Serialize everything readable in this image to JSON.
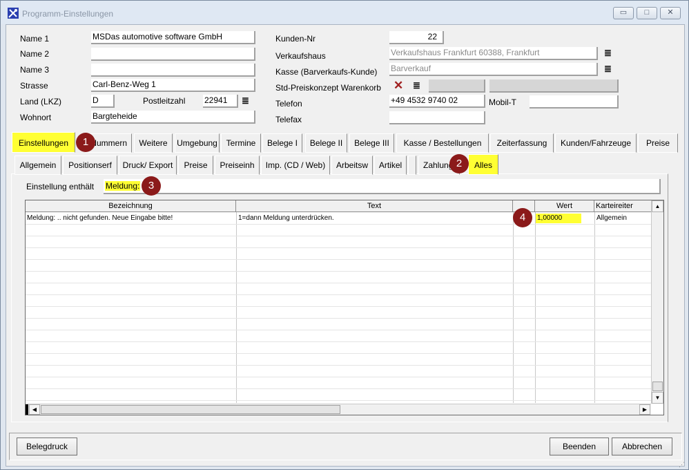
{
  "window": {
    "title": "Programm-Einstellungen",
    "min_glyph": "▭",
    "max_glyph": "□",
    "close_glyph": "✕"
  },
  "customer": {
    "name1_label": "Name 1",
    "name1_value": "MSDas automotive software GmbH",
    "name2_label": "Name 2",
    "name2_value": "",
    "name3_label": "Name 3",
    "name3_value": "",
    "strasse_label": "Strasse",
    "strasse_value": "Carl-Benz-Weg 1",
    "land_label": "Land (LKZ)",
    "land_value": "D",
    "plz_label": "Postleitzahl",
    "plz_value": "22941",
    "wohnort_label": "Wohnort",
    "wohnort_value": "Bargteheide",
    "kundennr_label": "Kunden-Nr",
    "kundennr_value": "22",
    "verkaufshaus_label": "Verkaufshaus",
    "verkaufshaus_value": "Verkaufshaus Frankfurt 60388, Frankfurt",
    "kasse_label": "Kasse (Barverkaufs-Kunde)",
    "kasse_value": "Barverkauf",
    "preiskonzept_label": "Std-Preiskonzept Warenkorb",
    "telefon_label": "Telefon",
    "telefon_value": "+49 4532 9740 02",
    "mobil_label": "Mobil-T",
    "mobil_value": "",
    "telefax_label": "Telefax",
    "telefax_value": ""
  },
  "main_tabs": [
    "Einstellungen",
    "Nummern",
    "Weitere",
    "Umgebung",
    "Termine",
    "Belege I",
    "Belege II",
    "Belege III",
    "Kasse / Bestellungen",
    "Zeiterfassung",
    "Kunden/Fahrzeuge",
    "Preise"
  ],
  "sub_tabs": [
    "Allgemein",
    "Positionserf",
    "Druck/ Export",
    "Preise",
    "Preiseinh",
    "Imp. (CD / Web)",
    "Arbeitsw",
    "Artikel",
    "",
    "Zahlung",
    "Alles"
  ],
  "filter": {
    "label": "Einstellung enthält",
    "value": "Meldung:"
  },
  "grid": {
    "columns": [
      "Bezeichnung",
      "Text",
      "",
      "Wert",
      "Karteireiter"
    ],
    "rows": [
      {
        "bezeichnung": "Meldung: .. nicht gefunden. Neue Eingabe bitte!",
        "text": "1=dann Meldung unterdrücken.",
        "wert": "1,00000",
        "karteireiter": "Allgemein"
      }
    ]
  },
  "badges": [
    "1",
    "2",
    "3",
    "4"
  ],
  "buttons": {
    "belegdruck": "Belegdruck",
    "beenden": "Beenden",
    "abbrechen": "Abbrechen"
  },
  "colors": {
    "highlight": "#ffff33",
    "badge": "#8b1a1a",
    "titlebar": "#dfe8f3"
  },
  "icons": {
    "list": "≣",
    "delete": "✕"
  }
}
